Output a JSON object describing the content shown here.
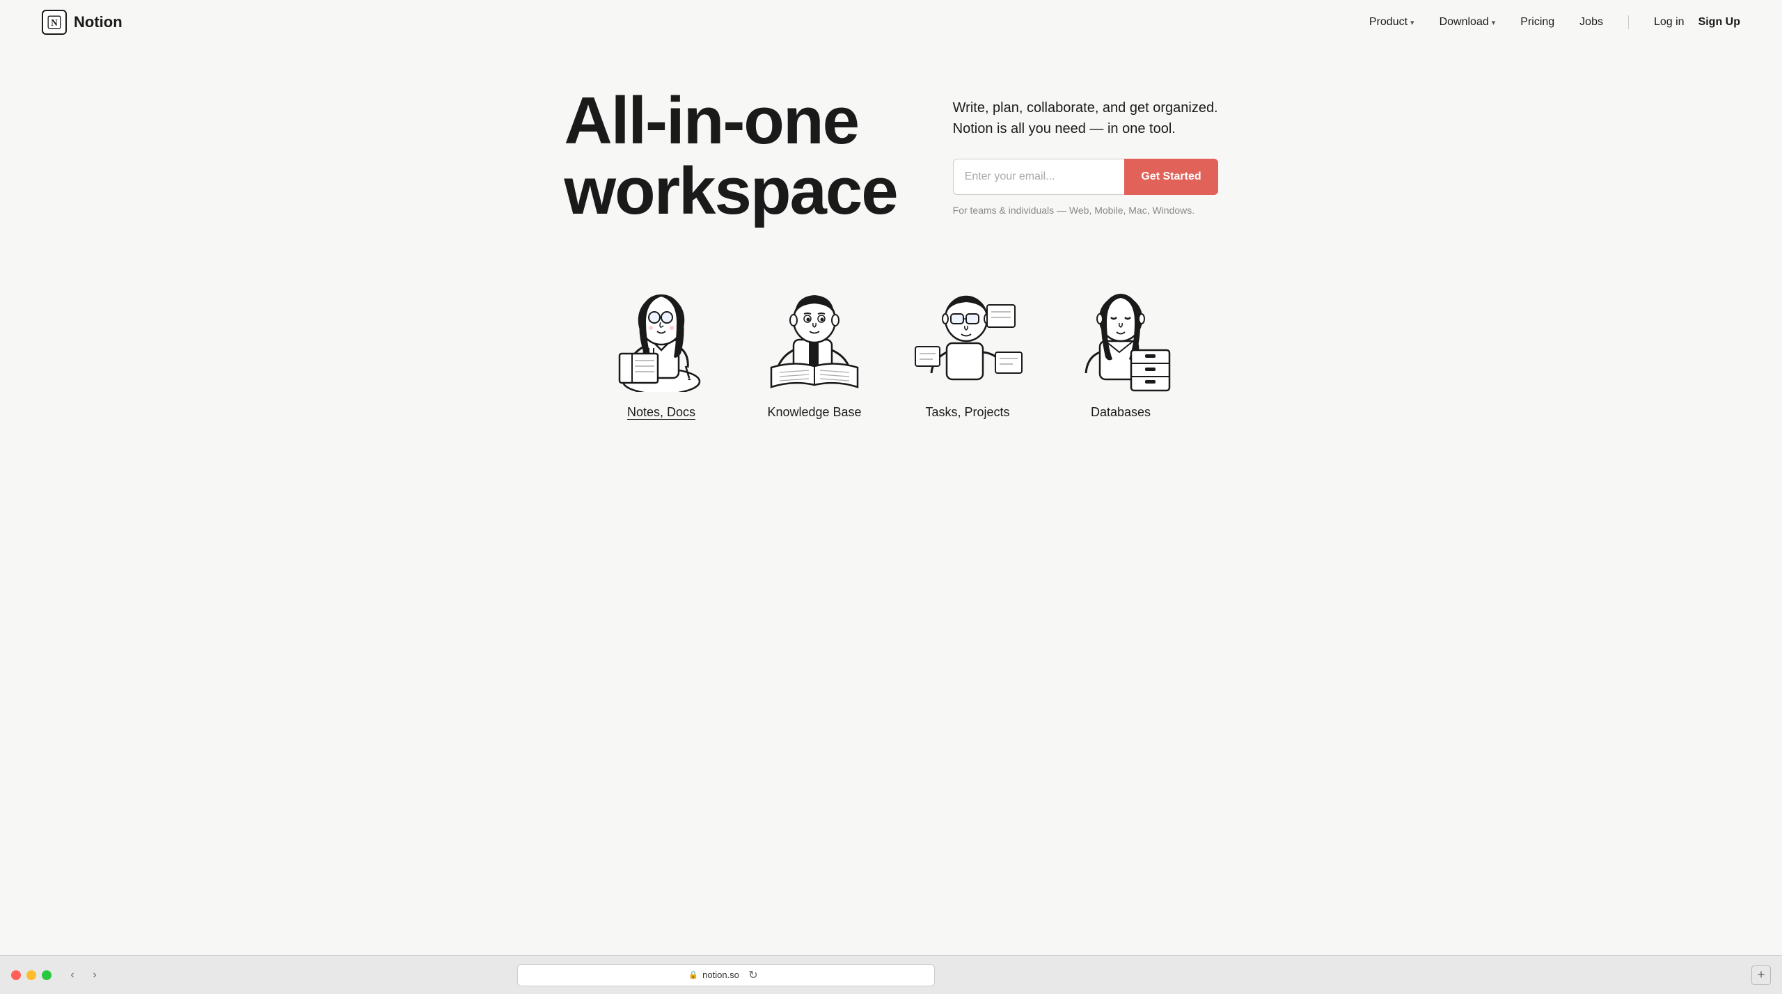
{
  "nav": {
    "brand": "Notion",
    "logo_letter": "N",
    "links": [
      {
        "id": "product",
        "label": "Product",
        "has_dropdown": true
      },
      {
        "id": "download",
        "label": "Download",
        "has_dropdown": true
      },
      {
        "id": "pricing",
        "label": "Pricing",
        "has_dropdown": false
      },
      {
        "id": "jobs",
        "label": "Jobs",
        "has_dropdown": false
      }
    ],
    "login_label": "Log in",
    "signup_label": "Sign Up"
  },
  "hero": {
    "title_line1": "All-in-one",
    "title_line2": "workspace",
    "subtitle_line1": "Write, plan, collaborate, and get organized.",
    "subtitle_line2": "Notion is all you need — in one tool.",
    "email_placeholder": "Enter your email...",
    "cta_button": "Get Started",
    "caption": "For teams & individuals — Web, Mobile, Mac, Windows."
  },
  "features": [
    {
      "id": "notes-docs",
      "label": "Notes, Docs",
      "underline": true
    },
    {
      "id": "knowledge-base",
      "label": "Knowledge Base",
      "underline": false
    },
    {
      "id": "tasks-projects",
      "label": "Tasks, Projects",
      "underline": false
    },
    {
      "id": "databases",
      "label": "Databases",
      "underline": false
    }
  ],
  "browser": {
    "url": "notion.so",
    "back_label": "‹",
    "forward_label": "›",
    "reload_label": "↻"
  },
  "colors": {
    "cta_button": "#e16259",
    "brand_bg": "#f7f7f5",
    "text_primary": "#1a1a1a"
  }
}
